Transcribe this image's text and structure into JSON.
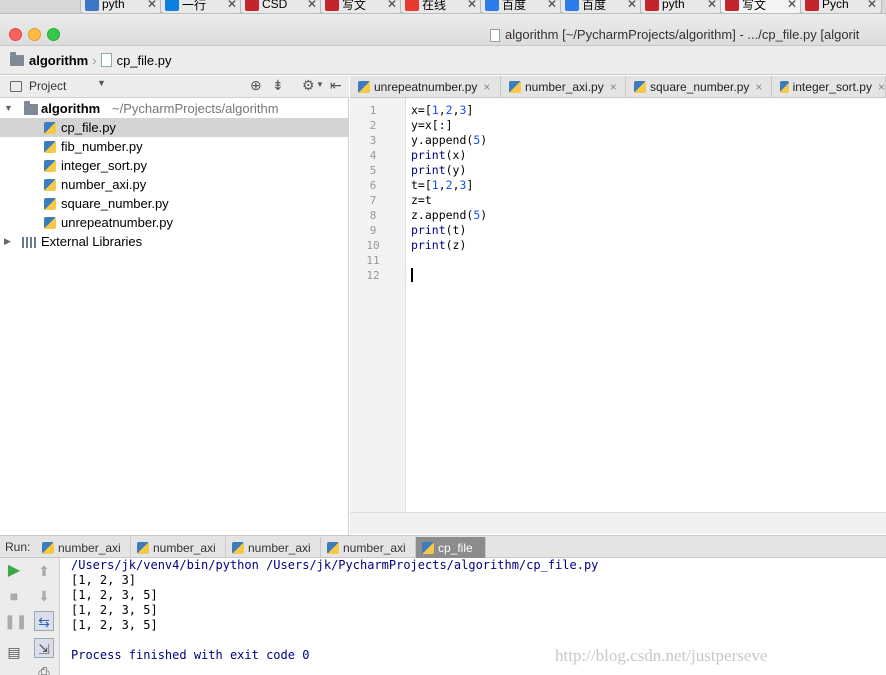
{
  "browser_tabs": [
    {
      "label": "pyth",
      "icon": "python-icon",
      "color": "#3b78c4"
    },
    {
      "label": "一行",
      "icon": "zhihu-icon",
      "color": "#0e7fe1"
    },
    {
      "label": "CSD",
      "icon": "csdn-icon",
      "color": "#c0262b"
    },
    {
      "label": "写文",
      "icon": "csdn-icon",
      "color": "#c0262b"
    },
    {
      "label": "在线",
      "icon": "sogou-icon",
      "color": "#e63b2e"
    },
    {
      "label": "百度",
      "icon": "baidu-translate-icon",
      "color": "#2b7de9"
    },
    {
      "label": "百度",
      "icon": "baidu-translate-icon",
      "color": "#2b7de9"
    },
    {
      "label": "pyth",
      "icon": "csdn-icon",
      "color": "#c0262b"
    },
    {
      "label": "写文",
      "icon": "csdn-icon",
      "color": "#c0262b"
    },
    {
      "label": "Pych",
      "icon": "csdn-icon",
      "color": "#c0262b"
    }
  ],
  "window": {
    "title": "algorithm [~/PycharmProjects/algorithm] - .../cp_file.py [algorit"
  },
  "navbar": {
    "project": "algorithm",
    "file": "cp_file.py"
  },
  "project_panel": {
    "header": "Project",
    "root": {
      "name": "algorithm",
      "path": "~/PycharmProjects/algorithm"
    },
    "files": [
      "cp_file.py",
      "fib_number.py",
      "integer_sort.py",
      "number_axi.py",
      "square_number.py",
      "unrepeatnumber.py"
    ],
    "external": "External Libraries",
    "selected_index": 0
  },
  "editor": {
    "tabs": [
      "unrepeatnumber.py",
      "number_axi.py",
      "square_number.py",
      "integer_sort.py"
    ],
    "lines": [
      "x=[1,2,3]",
      "y=x[:]",
      "y.append(5)",
      "print(x)",
      "print(y)",
      "t=[1,2,3]",
      "z=t",
      "z.append(5)",
      "print(t)",
      "print(z)",
      "",
      ""
    ],
    "current_line": 12
  },
  "run": {
    "label": "Run:",
    "tabs": [
      "number_axi",
      "number_axi",
      "number_axi",
      "number_axi",
      "cp_file"
    ],
    "active_tab": 4,
    "command": "/Users/jk/venv4/bin/python /Users/jk/PycharmProjects/algorithm/cp_file.py",
    "output": [
      "[1, 2, 3]",
      "[1, 2, 3, 5]",
      "[1, 2, 3, 5]",
      "[1, 2, 3, 5]"
    ],
    "finish": "Process finished with exit code 0"
  },
  "watermark": "http://blog.csdn.net/justperseve",
  "colors": {
    "accent_blue": "#1750eb",
    "console_blue": "#000080",
    "selection": "#d4d4d4",
    "current_line": "#fdf9e3"
  }
}
